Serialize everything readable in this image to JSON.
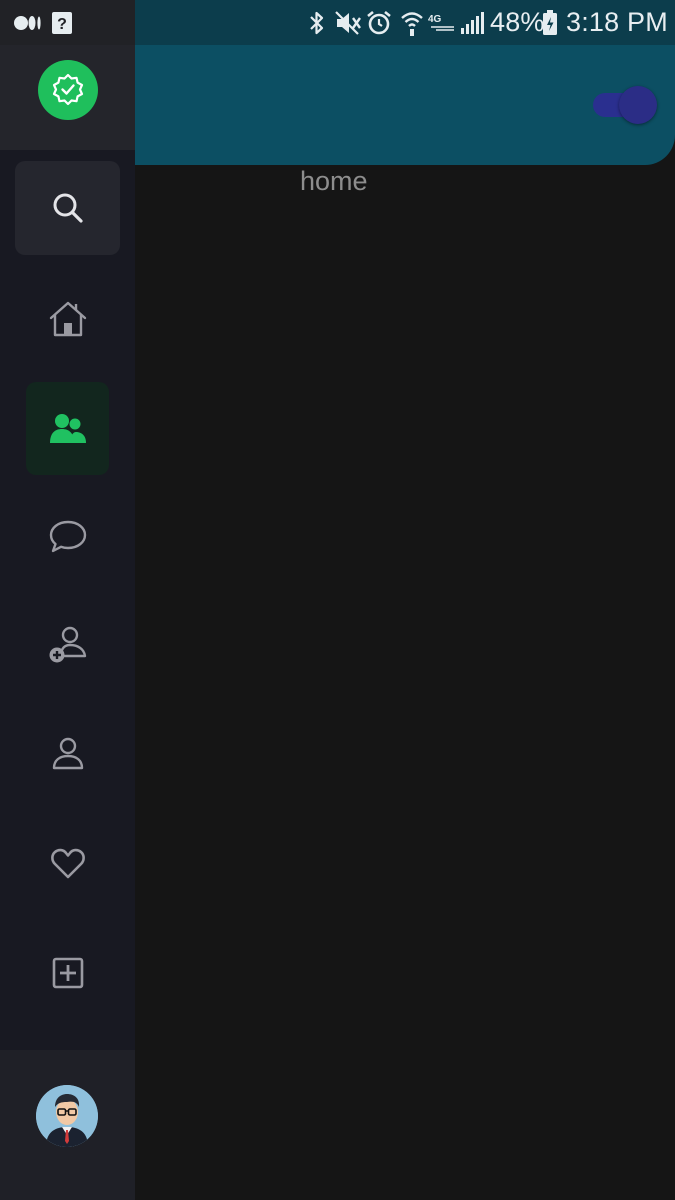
{
  "status_bar": {
    "battery": "48%",
    "time": "3:18 PM",
    "icons": [
      "medium-icon",
      "unknown-app-icon",
      "bluetooth-icon",
      "mute-icon",
      "alarm-icon",
      "wifi-calling-icon",
      "lte-icon",
      "signal-icon",
      "battery-charging-icon"
    ]
  },
  "header": {
    "toggle_state": "on",
    "page_label": "home"
  },
  "sidebar": {
    "logo_icon": "verified-badge-icon",
    "items": [
      {
        "name": "search",
        "icon": "search-icon",
        "active": false
      },
      {
        "name": "home",
        "icon": "home-icon",
        "active": false
      },
      {
        "name": "groups",
        "icon": "users-icon",
        "active": true
      },
      {
        "name": "messages",
        "icon": "chat-bubble-icon",
        "active": false
      },
      {
        "name": "add-friend",
        "icon": "add-user-icon",
        "active": false
      },
      {
        "name": "profile",
        "icon": "user-icon",
        "active": false
      },
      {
        "name": "favorites",
        "icon": "heart-icon",
        "active": false
      },
      {
        "name": "create",
        "icon": "plus-square-icon",
        "active": false
      }
    ],
    "avatar_icon": "avatar"
  },
  "colors": {
    "accent": "#1fbf5c",
    "header": "#0c4f63",
    "status_bar": "#0c3d4c",
    "sidebar": "#181922",
    "background": "#151515",
    "toggle": "#2a2f8f"
  }
}
